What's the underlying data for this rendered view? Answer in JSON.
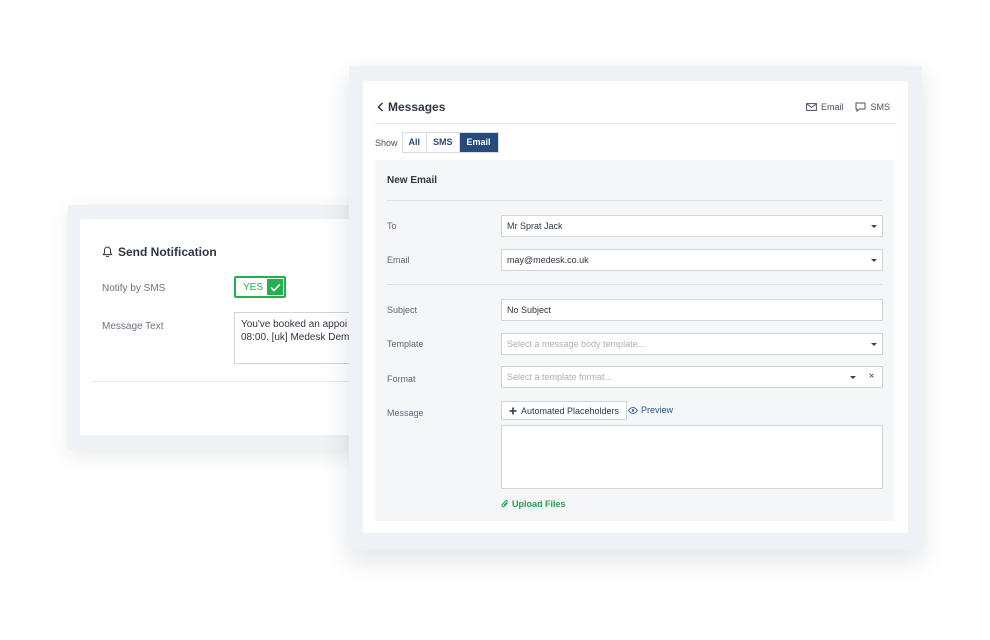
{
  "notification": {
    "title": "Send Notification",
    "notify_sms_label": "Notify by SMS",
    "toggle_label": "YES",
    "message_label": "Message Text",
    "message_text_line1": "You've booked an appoi",
    "message_text_line2": "08:00. [uk] Medesk Dem"
  },
  "messages": {
    "title": "Messages",
    "header_actions": {
      "email": "Email",
      "sms": "SMS"
    },
    "show_label": "Show",
    "filters": [
      "All",
      "SMS",
      "Email"
    ],
    "active_filter": "Email",
    "form": {
      "title": "New Email",
      "to_label": "To",
      "to_value": "Mr Sprat Jack",
      "email_label": "Email",
      "email_value": "may@medesk.co.uk",
      "subject_label": "Subject",
      "subject_value": "No Subject",
      "template_label": "Template",
      "template_placeholder": "Select a message body template...",
      "format_label": "Format",
      "format_placeholder": "Select a template format...",
      "clear_symbol": "×",
      "message_label": "Message",
      "placeholders_button": "Automated Placeholders",
      "preview_link": "Preview",
      "upload_link": "Upload Files"
    }
  },
  "colors": {
    "accent_blue": "#254a7c",
    "success_green": "#22b14c",
    "panel_bg": "#eef1f5"
  }
}
